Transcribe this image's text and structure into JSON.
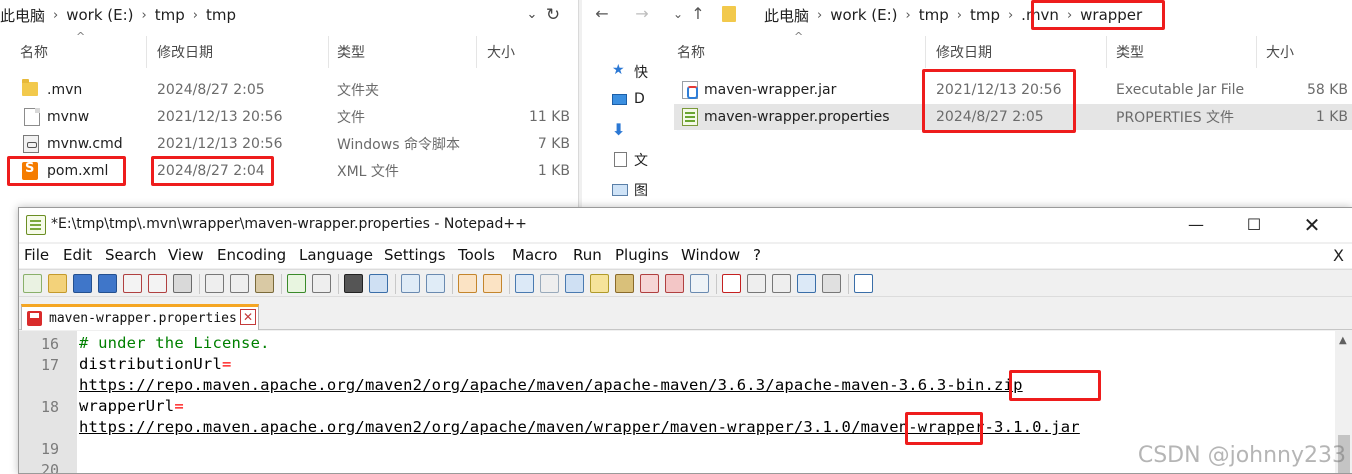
{
  "left_explorer": {
    "breadcrumbs": [
      "此电脑",
      "work (E:)",
      "tmp",
      "tmp"
    ],
    "columns": [
      "名称",
      "修改日期",
      "类型",
      "大小"
    ],
    "files": [
      {
        "name": ".mvn",
        "date": "2024/8/27 2:05",
        "type": "文件夹",
        "size": "",
        "icon": "folder-icon"
      },
      {
        "name": "mvnw",
        "date": "2021/12/13 20:56",
        "type": "文件",
        "size": "11 KB",
        "icon": "file-icon"
      },
      {
        "name": "mvnw.cmd",
        "date": "2021/12/13 20:56",
        "type": "Windows 命令脚本",
        "size": "7 KB",
        "icon": "cmd-icon"
      },
      {
        "name": "pom.xml",
        "date": "2024/8/27 2:04",
        "type": "XML 文件",
        "size": "1 KB",
        "icon": "xml-icon"
      }
    ]
  },
  "right_explorer": {
    "breadcrumbs": [
      "此电脑",
      "work (E:)",
      "tmp",
      "tmp",
      ".mvn",
      "wrapper"
    ],
    "columns": [
      "名称",
      "修改日期",
      "类型",
      "大小"
    ],
    "nav_items": [
      "快",
      "D",
      "",
      "文",
      "图"
    ],
    "files": [
      {
        "name": "maven-wrapper.jar",
        "date": "2021/12/13 20:56",
        "type": "Executable Jar File",
        "size": "58 KB",
        "icon": "jar-icon"
      },
      {
        "name": "maven-wrapper.properties",
        "date": "2024/8/27 2:05",
        "type": "PROPERTIES 文件",
        "size": "1 KB",
        "icon": "properties-icon",
        "selected": true
      }
    ]
  },
  "notepad": {
    "title": "*E:\\tmp\\tmp\\.mvn\\wrapper\\maven-wrapper.properties - Notepad++",
    "menu": [
      "File",
      "Edit",
      "Search",
      "View",
      "Encoding",
      "Language",
      "Settings",
      "Tools",
      "Macro",
      "Run",
      "Plugins",
      "Window",
      "?"
    ],
    "menu_close": "X",
    "tab_label": "maven-wrapper.properties",
    "lines": [
      {
        "num": "16",
        "text": "# under the License."
      },
      {
        "num": "17",
        "key": "distributionUrl",
        "eq": "="
      },
      {
        "num": "",
        "url": "https://repo.maven.apache.org/maven2/org/apache/maven/apache-maven/3.6.3/apache-maven-3.6.3-bin.zip"
      },
      {
        "num": "18",
        "key": "wrapperUrl",
        "eq": "="
      },
      {
        "num": "",
        "url": "https://repo.maven.apache.org/maven2/org/apache/maven/wrapper/maven-wrapper/3.1.0/maven-wrapper-3.1.0.jar"
      },
      {
        "num": "19"
      },
      {
        "num": "20"
      }
    ]
  },
  "watermark": "CSDN @johnny233",
  "highlight_color": "#ee1c1c"
}
